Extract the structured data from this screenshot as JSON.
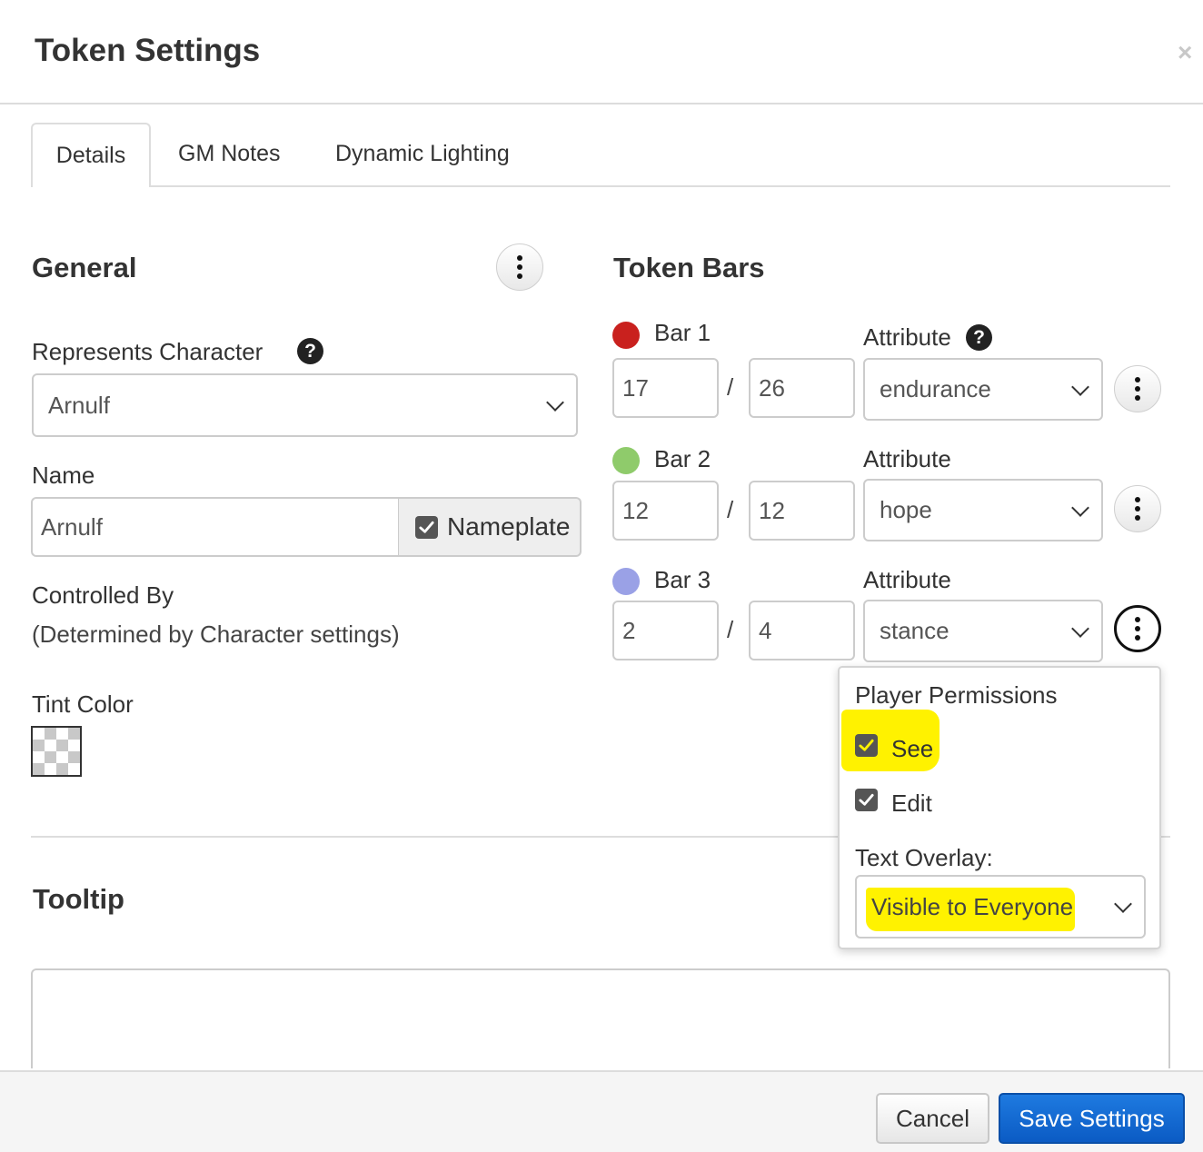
{
  "dialog": {
    "title": "Token Settings",
    "close_glyph": "×"
  },
  "tabs": [
    {
      "label": "Details",
      "active": true
    },
    {
      "label": "GM Notes",
      "active": false
    },
    {
      "label": "Dynamic Lighting",
      "active": false
    }
  ],
  "general": {
    "heading": "General",
    "menu_icon": "kebab-icon",
    "represents_label": "Represents Character",
    "help_glyph": "?",
    "represents_value": "Arnulf",
    "name_label": "Name",
    "name_value": "Arnulf",
    "nameplate_label": "Nameplate",
    "nameplate_checked": true,
    "controlled_label": "Controlled By",
    "controlled_note": "(Determined by Character settings)",
    "tint_label": "Tint Color"
  },
  "token_bars": {
    "heading": "Token Bars",
    "attribute_label": "Attribute",
    "help_glyph": "?",
    "separator": "/",
    "bars": [
      {
        "label": "Bar 1",
        "color": "#c9211e",
        "current": "17",
        "max": "26",
        "attribute": "endurance"
      },
      {
        "label": "Bar 2",
        "color": "#8fcb6b",
        "current": "12",
        "max": "12",
        "attribute": "hope"
      },
      {
        "label": "Bar 3",
        "color": "#9aa1e6",
        "current": "2",
        "max": "4",
        "attribute": "stance"
      }
    ]
  },
  "permissions_popover": {
    "heading": "Player Permissions",
    "see_label": "See",
    "see_checked": true,
    "edit_label": "Edit",
    "edit_checked": true,
    "overlay_label": "Text Overlay:",
    "overlay_value": "Visible to Everyone",
    "highlight_color": "#fff200"
  },
  "tooltip": {
    "heading": "Tooltip",
    "value": ""
  },
  "footer": {
    "cancel_label": "Cancel",
    "save_label": "Save Settings"
  },
  "colors": {
    "primary_button": "#1a6fd6",
    "text": "#333333",
    "border": "#cccccc"
  }
}
